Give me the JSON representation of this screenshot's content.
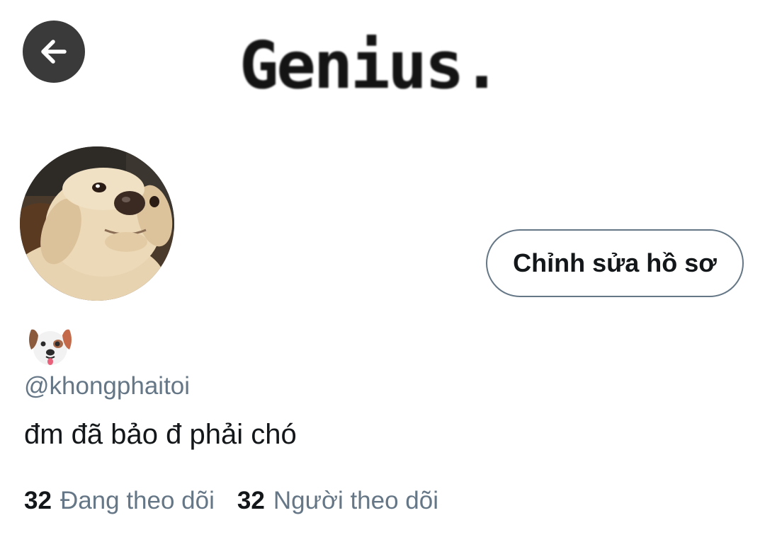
{
  "banner": {
    "text": "Genius."
  },
  "header": {
    "back_icon": "arrow-left-icon"
  },
  "profile": {
    "avatar_description": "puppy-photo",
    "edit_button_label": "Chỉnh sửa hồ sơ",
    "display_name_icon": "dog-face-emoji",
    "handle": "@khongphaitoi",
    "bio": "đm đã bảo đ phải chó"
  },
  "stats": {
    "following_count": "32",
    "following_label": "Đang theo dõi",
    "followers_count": "32",
    "followers_label": "Người theo dõi"
  },
  "colors": {
    "text_primary": "#14171a",
    "text_secondary": "#657786",
    "back_button_bg": "#3a3a3a"
  }
}
